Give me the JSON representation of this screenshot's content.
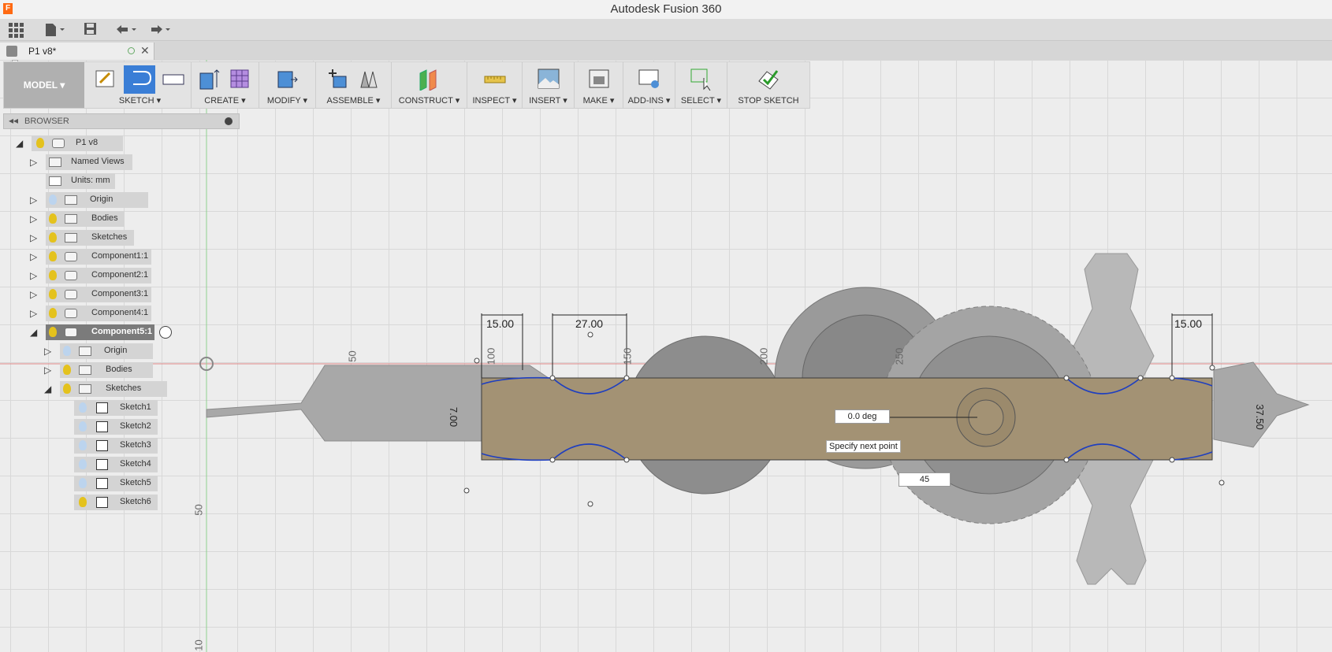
{
  "window": {
    "title": "Autodesk Fusion 360",
    "logo": "F"
  },
  "quick_access": {
    "grid_icon": "apps-grid-icon",
    "file_icon": "file-icon",
    "save_icon": "save-icon",
    "undo_icon": "undo-icon",
    "redo_icon": "redo-icon"
  },
  "document_tab": {
    "label": "P1 v8*"
  },
  "toolbar": {
    "workspace": "MODEL ▾",
    "groups": [
      {
        "label": "SKETCH ▾"
      },
      {
        "label": "CREATE ▾"
      },
      {
        "label": "MODIFY ▾"
      },
      {
        "label": "ASSEMBLE ▾"
      },
      {
        "label": "CONSTRUCT ▾"
      },
      {
        "label": "INSPECT ▾"
      },
      {
        "label": "INSERT ▾"
      },
      {
        "label": "MAKE ▾"
      },
      {
        "label": "ADD-INS ▾"
      },
      {
        "label": "SELECT ▾"
      },
      {
        "label": "STOP SKETCH"
      }
    ]
  },
  "browser": {
    "title": "BROWSER",
    "root": "P1 v8",
    "items": [
      {
        "label": "Named Views"
      },
      {
        "label": "Units: mm"
      },
      {
        "label": "Origin"
      },
      {
        "label": "Bodies"
      },
      {
        "label": "Sketches"
      },
      {
        "label": "Component1:1"
      },
      {
        "label": "Component2:1"
      },
      {
        "label": "Component3:1"
      },
      {
        "label": "Component4:1"
      },
      {
        "label": "Component5:1"
      },
      {
        "label": "Origin"
      },
      {
        "label": "Bodies"
      },
      {
        "label": "Sketches"
      },
      {
        "label": "Sketch1"
      },
      {
        "label": "Sketch2"
      },
      {
        "label": "Sketch3"
      },
      {
        "label": "Sketch4"
      },
      {
        "label": "Sketch5"
      },
      {
        "label": "Sketch6"
      }
    ]
  },
  "canvas": {
    "dims": {
      "d1": "15.00",
      "d2": "27.00",
      "d3": "15.00",
      "d4": "7.00",
      "d5": "37.50"
    },
    "ruler": {
      "r50a": "50",
      "r100": "100",
      "r150": "150",
      "r200": "200",
      "r250": "250",
      "r50b": "50",
      "r10": "10"
    },
    "angle_input": "0.0 deg",
    "length_input": "45",
    "tooltip": "Specify next point"
  }
}
